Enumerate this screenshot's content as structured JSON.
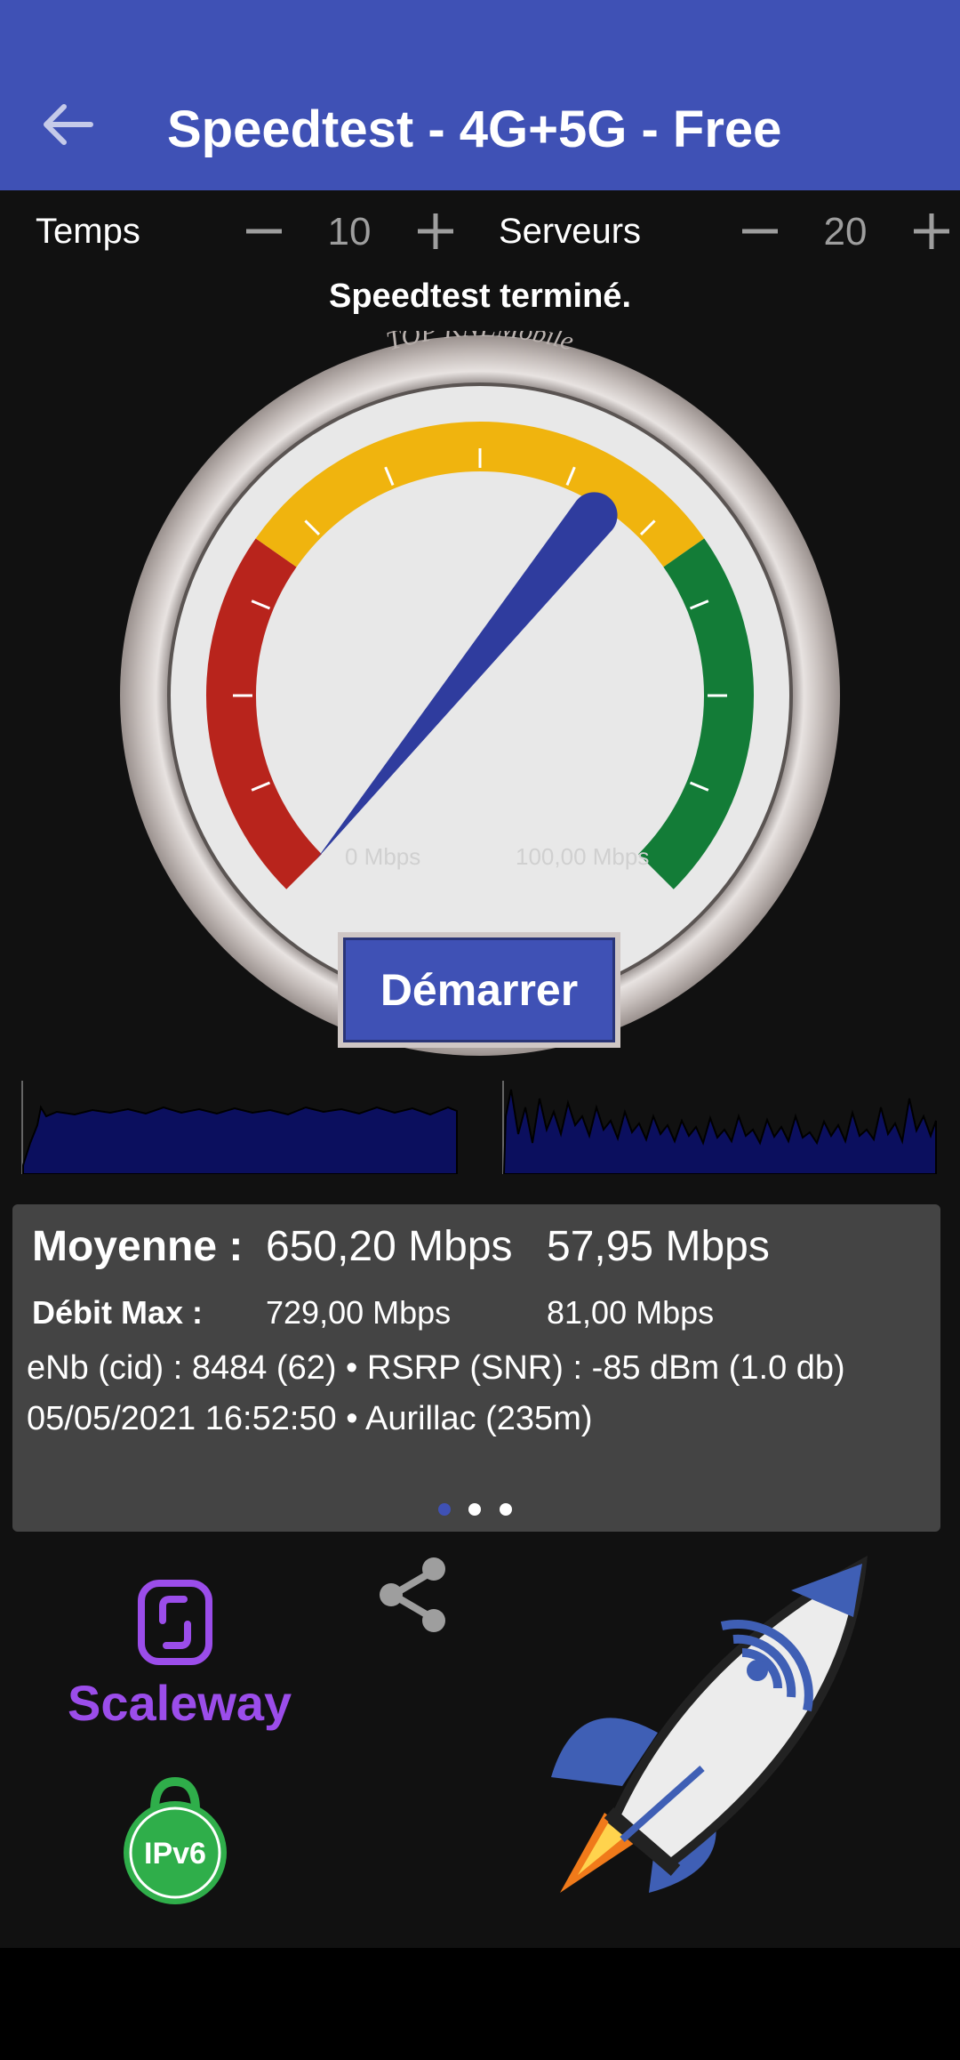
{
  "appbar": {
    "title": "Speedtest - 4G+5G - Free",
    "back_icon": "arrow-left-icon"
  },
  "controls": {
    "time_label": "Temps",
    "time_value": "10",
    "servers_label": "Serveurs",
    "servers_value": "20"
  },
  "status": "Speedtest terminé.",
  "gauge": {
    "brand_text": "TOP KNEMobile",
    "min_label": "0 Mbps",
    "max_label": "100,00 Mbps",
    "level_fraction": 0.62,
    "colors": {
      "low": "#b8241c",
      "mid": "#f0b40e",
      "high": "#137c37",
      "needle": "#2f3c9e"
    }
  },
  "start_button": "Démarrer",
  "results": {
    "average_label": "Moyenne :",
    "average_download": "650,20 Mbps",
    "average_upload": "57,95 Mbps",
    "max_label": "Débit Max :",
    "max_download": "729,00 Mbps",
    "max_upload": "81,00 Mbps",
    "cell_info": "eNb (cid) : 8484 (62)  •  RSRP (SNR) : -85 dBm (1.0 db)",
    "time_location": "05/05/2021 16:52:50  •  Aurillac (235m)",
    "pages": 3,
    "active_page": 0
  },
  "logos": {
    "scaleway": "Scaleway",
    "ipv6": "IPv6"
  },
  "colors": {
    "appbar": "#3f51b5",
    "panel": "#444444",
    "background": "#111111",
    "graph_fill": "#0b0f5e"
  }
}
